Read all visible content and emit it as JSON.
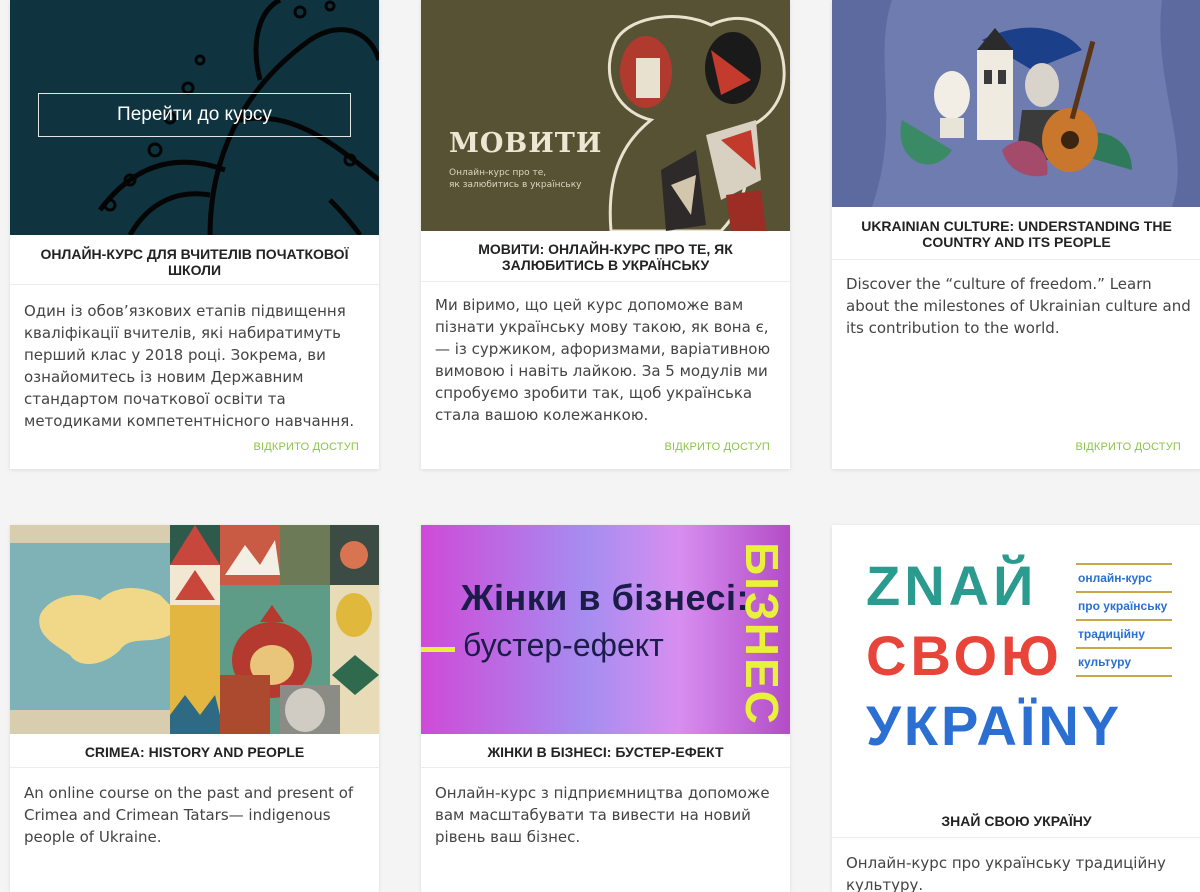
{
  "colors": {
    "page_bg": "#f4f4f4",
    "access_link": "#8cc44a",
    "title_text": "#222222",
    "body_text": "#444444"
  },
  "courses": [
    {
      "title": "ОНЛАЙН-КУРС ДЛЯ ВЧИТЕЛІВ ПОЧАТКОВОЇ ШКОЛИ",
      "description": "Один із обов’язкових етапів підвищення кваліфікації вчителів, які набиратимуть перший клас у 2018 році. Зокрема, ви ознайомитесь із новим Державним стандартом початкової освіти та методиками компетентнісного навчання.",
      "access": "ВІДКРИТО ДОСТУП",
      "hover_button": "Перейти до курсу"
    },
    {
      "title": "МОВИТИ: ОНЛАЙН-КУРС ПРО ТЕ, ЯК ЗАЛЮБИТИСЬ В УКРАЇНСЬКУ",
      "description": "Ми віримо, що цей курс допоможе вам пізнати українську мову такою, як вона є, — із суржиком, афоризмами, варіативною вимовою і навіть лайкою. За 5 модулів ми спробуємо зробити так, щоб українська стала вашою колежанкою.",
      "access": "ВІДКРИТО ДОСТУП",
      "image_logo": "МОВИТИ",
      "image_caption_1": "Онлайн-курс про те,",
      "image_caption_2": "як залюбитись в українську"
    },
    {
      "title": "UKRAINIAN CULTURE: UNDERSTANDING THE COUNTRY AND ITS PEOPLE",
      "description": "Discover the “culture of freedom.” Learn about the milestones of Ukrainian culture and its contribution to the world.",
      "access": "ВІДКРИТО ДОСТУП"
    },
    {
      "title": "CRIMEA: HISTORY AND PEOPLE",
      "description": "An online course on the past and present of Crimea and Crimean Tatars— indigenous people of Ukraine."
    },
    {
      "title": "ЖІНКИ В БІЗНЕСІ: БУСТЕР-ЕФЕКТ",
      "description": "Онлайн-курс з підприємництва допоможе вам масштабувати та вивести на новий рівень ваш бізнес.",
      "image_headline": "Жінки в бізнесі:",
      "image_subline": "бустер-ефект",
      "image_vertical": "БІЗНЕС"
    },
    {
      "title": "ЗНАЙ СВОЮ УКРАЇНУ",
      "description": "Онлайн-курс про українську традиційну культуру.",
      "image_logo_line_1": "ZNAЙ",
      "image_logo_line_2": "СВОЮ",
      "image_logo_line_3": "УКРАЇNY",
      "image_side_1": "онлайн-курс",
      "image_side_2": "про українську",
      "image_side_3": "традиційну",
      "image_side_4": "культуру"
    }
  ]
}
